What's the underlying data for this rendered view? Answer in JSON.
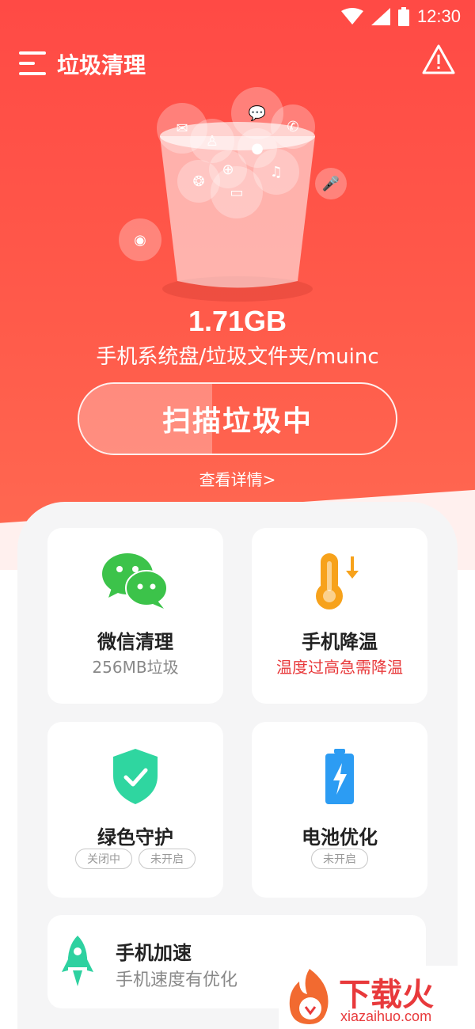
{
  "status": {
    "time": "12:30"
  },
  "appbar": {
    "title": "垃圾清理"
  },
  "scan": {
    "size": "1.71GB",
    "path": "手机系统盘/垃圾文件夹/muinc",
    "button_label": "扫描垃圾中",
    "progress": 0.42,
    "details_link": "查看详情>"
  },
  "features": {
    "wechat": {
      "title": "微信清理",
      "subtitle": "256MB垃圾"
    },
    "cooling": {
      "title": "手机降温",
      "subtitle": "温度过高急需降温",
      "accent": "#e8393b"
    },
    "guard": {
      "title": "绿色守护",
      "tags": [
        "关闭中",
        "未开启"
      ]
    },
    "battery": {
      "title": "电池优化",
      "tag": "未开启"
    },
    "speed": {
      "title": "手机加速",
      "subtitle": "手机速度有优化"
    }
  },
  "watermark": {
    "brand": "下载火",
    "url": "xiazaihuo.com"
  },
  "colors": {
    "primary": "#ff4a45",
    "wechat_green": "#3cc34a",
    "shield_green": "#2fd6a0",
    "thermo_orange": "#f7a21b",
    "battery_blue": "#2c9cf3",
    "rocket_green": "#2ed1a0"
  }
}
